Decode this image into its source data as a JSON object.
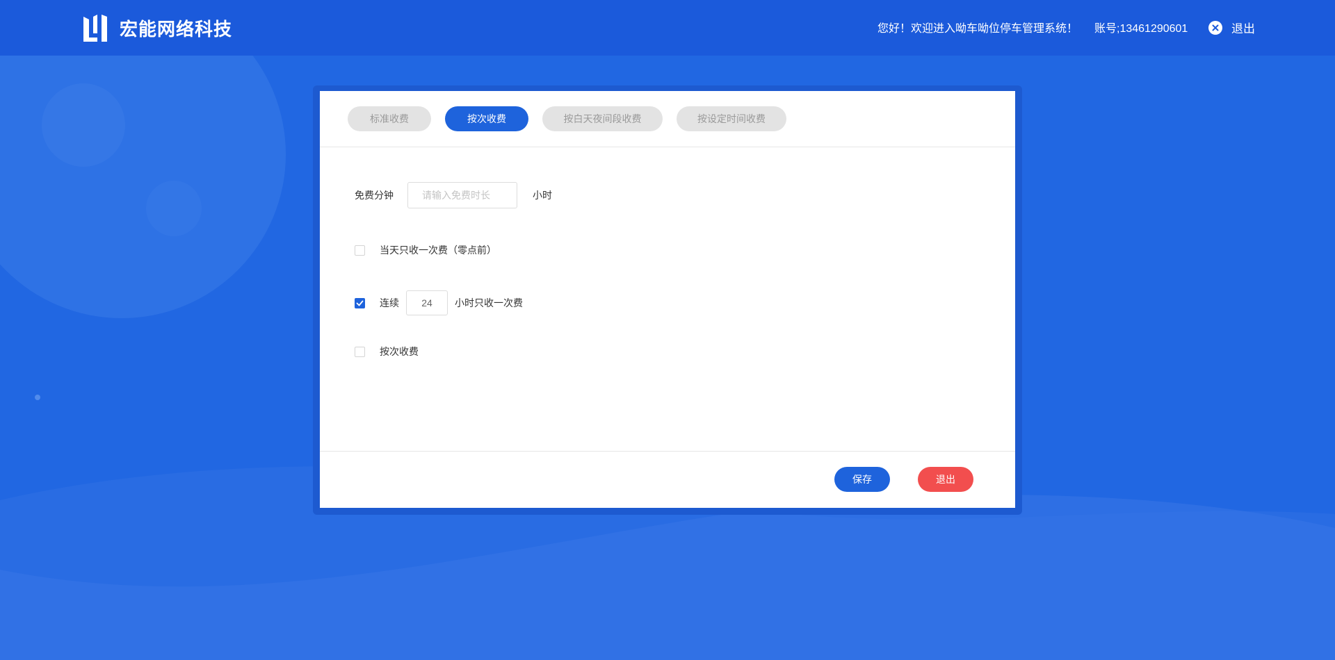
{
  "header": {
    "brand": "宏能网络科技",
    "welcome": "您好！欢迎进入呦车呦位停车管理系统！",
    "account": "账号;13461290601",
    "logout_label": "退出"
  },
  "tabs": [
    {
      "label": "标准收费",
      "active": false
    },
    {
      "label": "按次收费",
      "active": true
    },
    {
      "label": "按白天夜间段收费",
      "active": false
    },
    {
      "label": "按设定时间收费",
      "active": false
    }
  ],
  "form": {
    "free_label": "免费分钟",
    "free_placeholder": "请输入免费时长",
    "free_unit": "小时",
    "once_per_day": {
      "label": "当天只收一次费（零点前）",
      "checked": false
    },
    "continuous": {
      "prefix": "连续",
      "value": "24",
      "suffix": "小时只收一次费",
      "checked": true
    },
    "per_time": {
      "label": "按次收费",
      "checked": false
    }
  },
  "footer": {
    "save_label": "保存",
    "exit_label": "退出"
  },
  "colors": {
    "primary": "#1e63dc",
    "danger": "#f24e4e",
    "header_bg": "#1b5adb",
    "page_bg": "#2167e2"
  }
}
